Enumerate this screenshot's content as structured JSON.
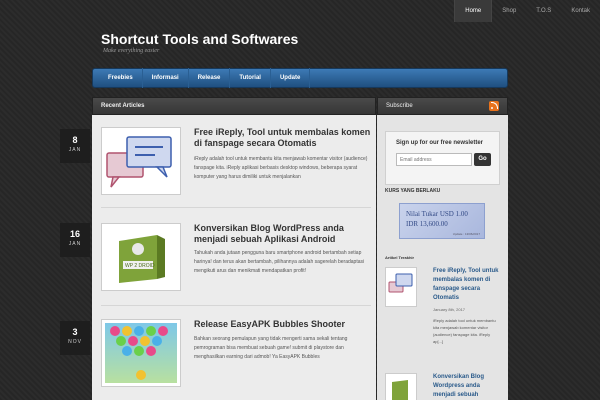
{
  "topnav": {
    "items": [
      {
        "label": "Home",
        "active": true
      },
      {
        "label": "Shop",
        "active": false
      },
      {
        "label": "T.O.S",
        "active": false
      },
      {
        "label": "Kontak",
        "active": false
      }
    ]
  },
  "header": {
    "title": "Shortcut Tools and Softwares",
    "tagline": "Make everything easier"
  },
  "mainmenu": {
    "items": [
      "Freebies",
      "Informasi",
      "Release",
      "Tutorial",
      "Update"
    ]
  },
  "content": {
    "heading": "Recent Articles",
    "posts": [
      {
        "day": "8",
        "month": "JAN",
        "title": "Free iReply, Tool untuk membalas komen di fanspage secara Otomatis",
        "excerpt": "iReply adalah tool untuk membantu kita menjawab komentar visitor (audience) fanspage kita. iReply aplikasi berbasis desktop windows, beberapa syarat komputer yang harus dimiliki untuk menjalankan",
        "thumb_icon": "chat-bubbles-icon"
      },
      {
        "day": "16",
        "month": "JAN",
        "title": "Konversikan Blog WordPress anda menjadi sebuah Aplikasi Android",
        "excerpt": "Tahukah anda jutaan pengguna baru smartphone android bertambah setiap harinya! dan terus akan bertambah, pilihannya adalah sagerelah beradaptasi mengikuti arus dan menikmati mendapatkan profit!",
        "thumb_label": "WP 2 DROID",
        "thumb_icon": "software-box-icon"
      },
      {
        "day": "3",
        "month": "NOV",
        "title": "Release EasyAPK Bubbles Shooter",
        "excerpt": "Bahkan seorang pemulapun yang tidak mengerti sama sekali tentang pemrograman bisa membuat sebuah game! submit di playstore dan menghasilkan earning dari admob! Ya EasyAPK Bubbles",
        "thumb_icon": "bubbles-game-icon"
      }
    ]
  },
  "sidebar": {
    "heading": "Subscribe",
    "newsletter": {
      "title": "Sign up for our free newsletter",
      "placeholder": "Email address",
      "button": "Go"
    },
    "kurs": {
      "title": "KURS YANG BERLAKU",
      "line1": "Nilai Tukar USD 1.00",
      "line2": "IDR 13,600.00",
      "line3": "Update : 13/06/2017"
    },
    "artikel": {
      "title": "Artikel Terakhir",
      "posts": [
        {
          "title": "Free iReply, Tool untuk membalas komen di fanspage secara Otomatis",
          "date": "January 8th, 2017",
          "excerpt": "iReply adalah tool untuk membantu kita menjawab komentar visitor (audience) fanspage kita. iReply ap[...]"
        },
        {
          "title": "Konversikan Blog Wordpress anda menjadi sebuah"
        }
      ]
    }
  },
  "colors": {
    "menu_blue": "#2a5f93",
    "rss_orange": "#e8721c"
  }
}
